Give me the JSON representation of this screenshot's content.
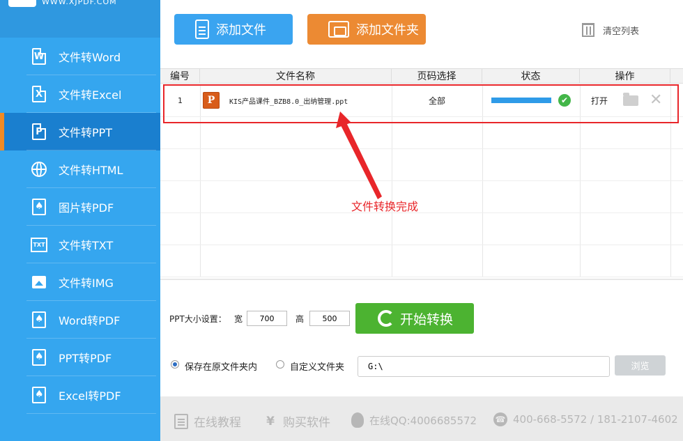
{
  "logo": {
    "text": "WWW.XJPDF.COM"
  },
  "sidebar": {
    "items": [
      {
        "label": "文件转Word",
        "icon": "word-doc-icon",
        "glyph": "W"
      },
      {
        "label": "文件转Excel",
        "icon": "excel-doc-icon",
        "glyph": "X"
      },
      {
        "label": "文件转PPT",
        "icon": "ppt-doc-icon",
        "glyph": "P",
        "active": true
      },
      {
        "label": "文件转HTML",
        "icon": "globe-icon"
      },
      {
        "label": "图片转PDF",
        "icon": "pdf-icon"
      },
      {
        "label": "文件转TXT",
        "icon": "txt-icon",
        "glyph": "TXT"
      },
      {
        "label": "文件转IMG",
        "icon": "image-icon"
      },
      {
        "label": "Word转PDF",
        "icon": "pdf-icon"
      },
      {
        "label": "PPT转PDF",
        "icon": "pdf-icon"
      },
      {
        "label": "Excel转PDF",
        "icon": "pdf-icon"
      }
    ]
  },
  "toolbar": {
    "add_file_label": "添加文件",
    "add_folder_label": "添加文件夹",
    "clear_list_label": "清空列表"
  },
  "table": {
    "headers": [
      "编号",
      "文件名称",
      "页码选择",
      "状态",
      "操作"
    ],
    "rows": [
      {
        "no": "1",
        "icon_glyph": "P",
        "file_name": "KIS产品课件_BZB8.0_出纳管理.ppt",
        "pages": "全部",
        "progress": 1.0,
        "status_glyph": "✔",
        "open_label": "打开"
      }
    ]
  },
  "annotation": {
    "text": "文件转换完成",
    "color": "#e8262a"
  },
  "settings": {
    "ppt_size_label": "PPT大小设置：",
    "width_label": "宽",
    "width_value": "700",
    "height_label": "高",
    "height_value": "500",
    "start_label": "开始转换",
    "save_original_label": "保存在原文件夹内",
    "custom_folder_label": "自定义文件夹",
    "path_value": "G:\\",
    "browse_label": "浏览"
  },
  "footer": {
    "tutorial_label": "在线教程",
    "buy_glyph": "¥",
    "buy_label": "购买软件",
    "qq_label": "在线QQ:4006685572",
    "phone_label": "400-668-5572 / 181-2107-4602"
  },
  "colors": {
    "sidebar_bg": "#35a6ef",
    "active_bg": "#1a7fcf",
    "accent_orange": "#ec8a33",
    "start_green": "#4cb331",
    "highlight_red": "#e8262a"
  }
}
